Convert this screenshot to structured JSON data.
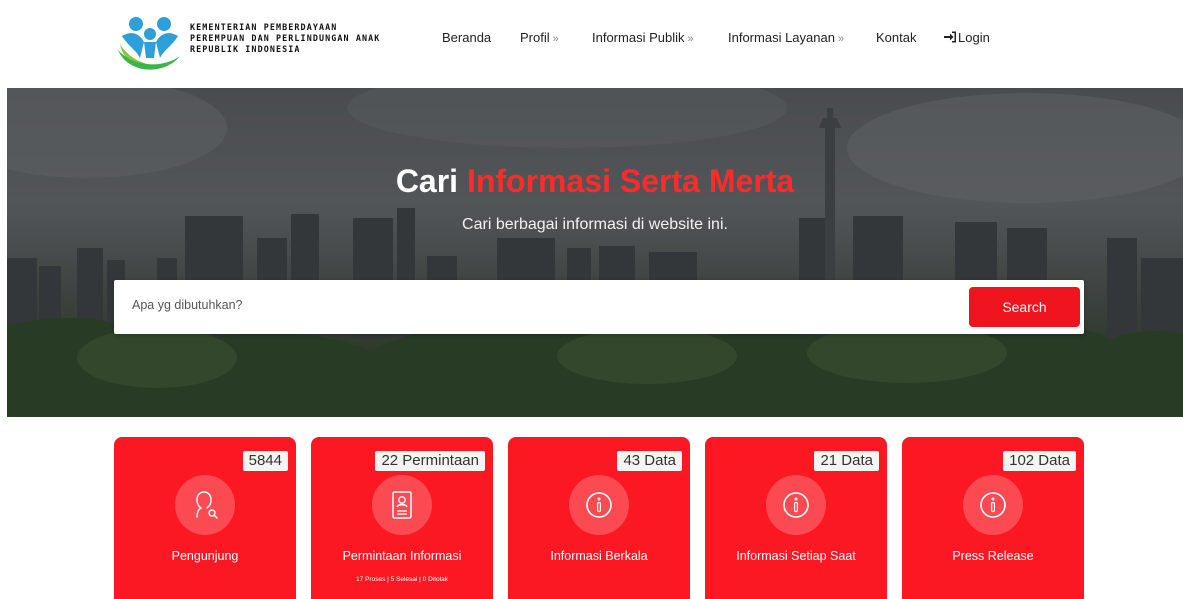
{
  "header": {
    "logo_lines": [
      "KEMENTERIAN PEMBERDAYAAN",
      "PEREMPUAN DAN PERLINDUNGAN ANAK",
      "REPUBLIK INDONESIA"
    ],
    "nav": [
      {
        "label": "Beranda",
        "has_chevron": false
      },
      {
        "label": "Profil",
        "has_chevron": true
      },
      {
        "label": "Informasi Publik",
        "has_chevron": true
      },
      {
        "label": "Informasi Layanan",
        "has_chevron": true
      },
      {
        "label": "Kontak",
        "has_chevron": false
      },
      {
        "label": "Login",
        "has_chevron": false
      }
    ],
    "chevron": "»"
  },
  "hero": {
    "title_plain": "Cari",
    "title_accent": "Informasi Serta Merta",
    "subtitle": "Cari berbagai informasi di website ini.",
    "search_placeholder": "Apa yg dibutuhkan?",
    "search_button": "Search"
  },
  "cards": [
    {
      "badge": "5844",
      "label": "Pengunjung",
      "icon": "visitor-icon",
      "sub": ""
    },
    {
      "badge": "22 Permintaan",
      "label": "Permintaan Informasi",
      "icon": "document-icon",
      "sub": "17 Proses | 5 Selesai | 0 Ditolak"
    },
    {
      "badge": "43 Data",
      "label": "Informasi Berkala",
      "icon": "info-icon",
      "sub": ""
    },
    {
      "badge": "21 Data",
      "label": "Informasi Setiap Saat",
      "icon": "info-icon",
      "sub": ""
    },
    {
      "badge": "102 Data",
      "label": "Press Release",
      "icon": "info-icon",
      "sub": ""
    }
  ],
  "colors": {
    "accent": "#f0141f",
    "card": "#fb1823",
    "title_accent": "#ff2b2b"
  }
}
